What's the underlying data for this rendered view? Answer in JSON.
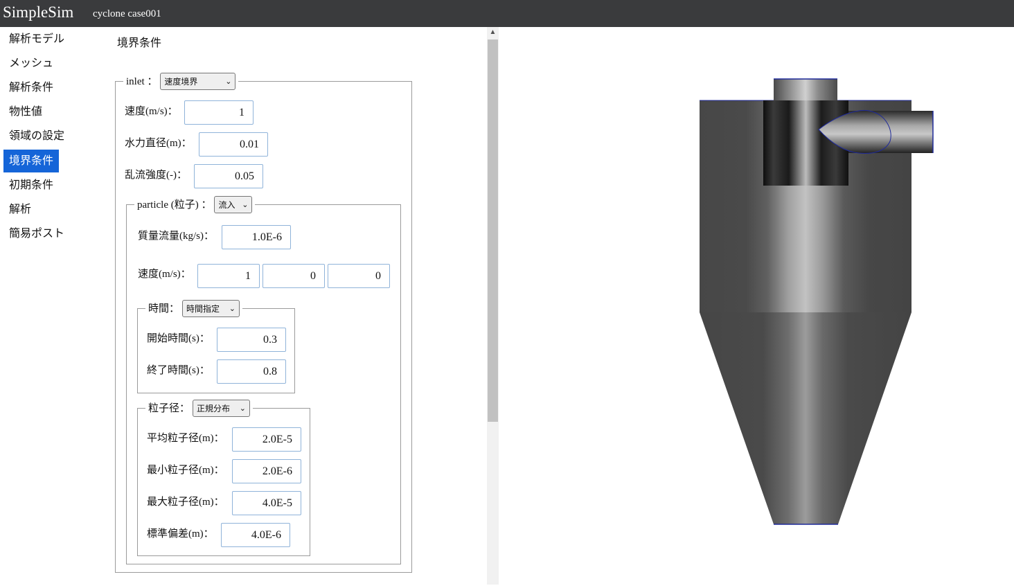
{
  "header": {
    "app_title": "SimpleSim",
    "case_title": "cyclone case001"
  },
  "sidebar": {
    "items": [
      {
        "label": "解析モデル"
      },
      {
        "label": "メッシュ"
      },
      {
        "label": "解析条件"
      },
      {
        "label": "物性値"
      },
      {
        "label": "領域の設定"
      },
      {
        "label": "境界条件",
        "active": true
      },
      {
        "label": "初期条件"
      },
      {
        "label": "解析"
      },
      {
        "label": "簡易ポスト"
      }
    ]
  },
  "panel": {
    "title": "境界条件",
    "inlet": {
      "legend": "inlet ：",
      "type": "速度境界",
      "velocity_label": "速度(m/s)：",
      "velocity": "1",
      "hydraulic_diameter_label": "水力直径(m)：",
      "hydraulic_diameter": "0.01",
      "turbulence_label": "乱流強度(-)：",
      "turbulence": "0.05"
    },
    "particle": {
      "legend": "particle (粒子) ：",
      "type": "流入",
      "mass_flow_label": "質量流量(kg/s)：",
      "mass_flow": "1.0E-6",
      "velocity_label": "速度(m/s)：",
      "velocity": [
        "1",
        "0",
        "0"
      ],
      "time": {
        "legend": "時間：",
        "type": "時間指定",
        "start_label": "開始時間(s)：",
        "start": "0.3",
        "end_label": "終了時間(s)：",
        "end": "0.8"
      },
      "diameter": {
        "legend": "粒子径：",
        "type": "正規分布",
        "mean_label": "平均粒子径(m)：",
        "mean": "2.0E-5",
        "min_label": "最小粒子径(m)：",
        "min": "2.0E-6",
        "max_label": "最大粒子径(m)：",
        "max": "4.0E-5",
        "std_label": "標準偏差(m)：",
        "std": "4.0E-6"
      }
    }
  },
  "colors": {
    "header_bg": "#3a3b3d",
    "active_item": "#1565d8",
    "model_edge": "#1f2a9a"
  }
}
